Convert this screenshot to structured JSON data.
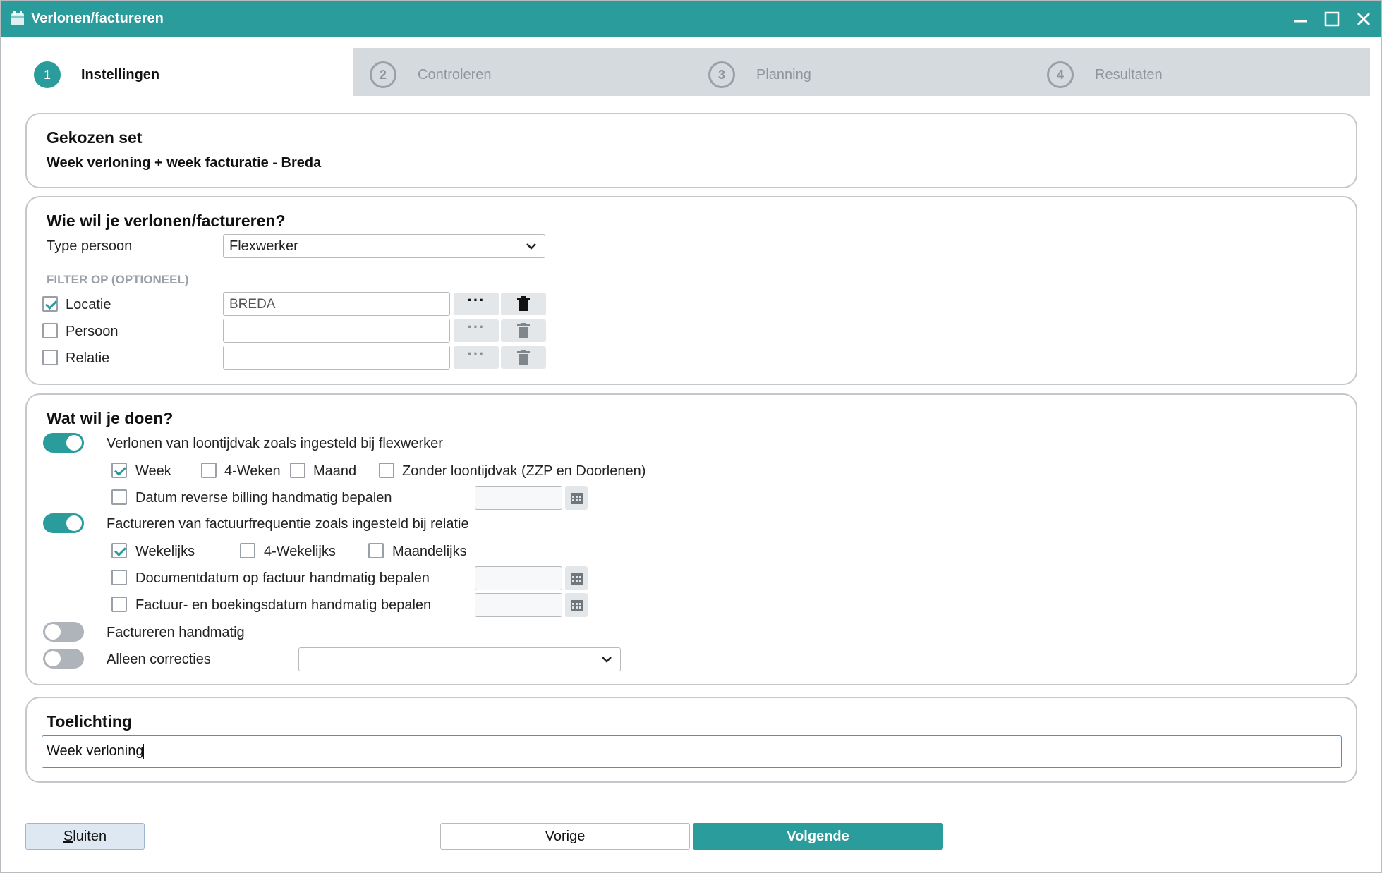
{
  "window": {
    "title": "Verlonen/factureren"
  },
  "steps": [
    {
      "number": "1",
      "label": "Instellingen"
    },
    {
      "number": "2",
      "label": "Controleren"
    },
    {
      "number": "3",
      "label": "Planning"
    },
    {
      "number": "4",
      "label": "Resultaten"
    }
  ],
  "set_panel": {
    "heading": "Gekozen set",
    "value": "Week verloning + week facturatie - Breda"
  },
  "who_panel": {
    "heading": "Wie wil je verlonen/factureren?",
    "type_label": "Type persoon",
    "type_value": "Flexwerker",
    "filter_heading": "FILTER OP (OPTIONEEL)",
    "filters": [
      {
        "label": "Locatie",
        "checked": true,
        "value": "BREDA"
      },
      {
        "label": "Persoon",
        "checked": false,
        "value": ""
      },
      {
        "label": "Relatie",
        "checked": false,
        "value": ""
      }
    ],
    "more_label": "···"
  },
  "what_panel": {
    "heading": "Wat wil je doen?",
    "payroll_toggle_label": "Verlonen van loontijdvak zoals ingesteld bij flexwerker",
    "payroll_options": [
      {
        "label": "Week",
        "checked": true
      },
      {
        "label": "4-Weken",
        "checked": false
      },
      {
        "label": "Maand",
        "checked": false
      },
      {
        "label": "Zonder loontijdvak (ZZP en Doorlenen)",
        "checked": false
      }
    ],
    "reverse_billing_label": "Datum reverse billing handmatig bepalen",
    "invoice_toggle_label": "Factureren van factuurfrequentie zoals ingesteld bij relatie",
    "invoice_options": [
      {
        "label": "Wekelijks",
        "checked": true
      },
      {
        "label": "4-Wekelijks",
        "checked": false
      },
      {
        "label": "Maandelijks",
        "checked": false
      }
    ],
    "document_date_label": "Documentdatum op factuur handmatig bepalen",
    "booking_date_label": "Factuur- en boekingsdatum handmatig bepalen",
    "manual_invoice_label": "Factureren handmatig",
    "corrections_label": "Alleen correcties",
    "corrections_value": ""
  },
  "note_panel": {
    "heading": "Toelichting",
    "value": "Week verloning"
  },
  "buttons": {
    "close_first": "S",
    "close_rest": "luiten",
    "previous": "Vorige",
    "next": "Volgende"
  },
  "colors": {
    "accent": "#2b9c9c",
    "step_bg": "#d5dade"
  }
}
